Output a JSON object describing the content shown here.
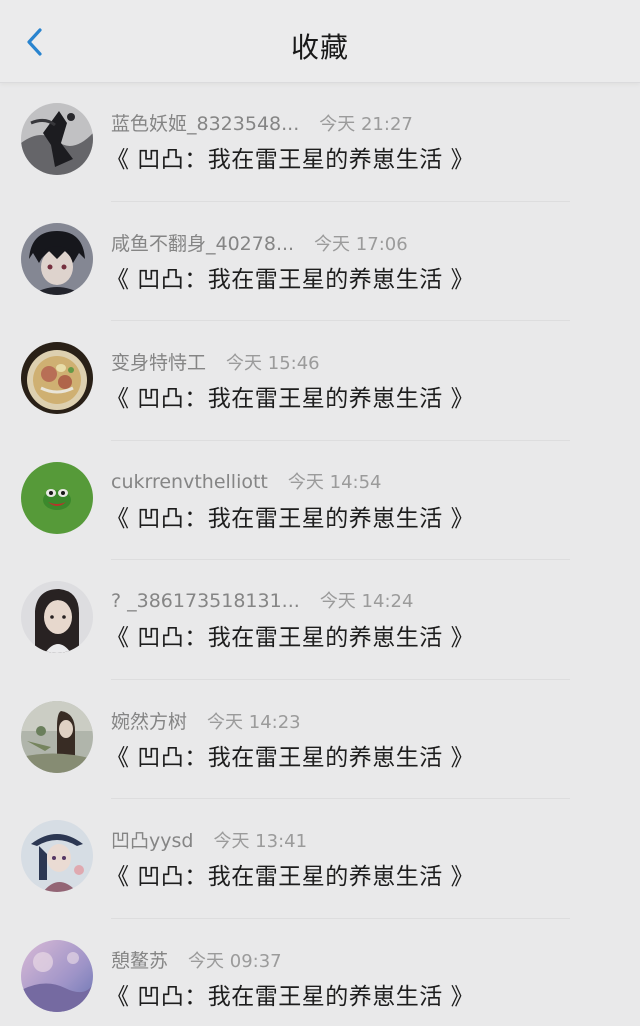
{
  "header": {
    "title": "收藏",
    "back_icon": "chevron-left-icon",
    "accent_color": "#2b8ad8"
  },
  "items": [
    {
      "name": "蓝色妖姬_8323548...",
      "time": "今天 21:27",
      "work": "《 凹凸：我在雷王星的养崽生活 》",
      "avatar": "dark-ink-art-avatar"
    },
    {
      "name": "咸鱼不翻身_40278...",
      "time": "今天 17:06",
      "work": "《 凹凸：我在雷王星的养崽生活 》",
      "avatar": "anime-boy-avatar"
    },
    {
      "name": "变身特恃工",
      "time": "今天 15:46",
      "work": "《 凹凸：我在雷王星的养崽生活 》",
      "avatar": "ramen-bowl-avatar"
    },
    {
      "name": "cukrrenvthelliott",
      "time": "今天 14:54",
      "work": "《 凹凸：我在雷王星的养崽生活 》",
      "avatar": "green-frog-avatar"
    },
    {
      "name": "? _386173518131...",
      "time": "今天 14:24",
      "work": "《 凹凸：我在雷王星的养崽生活 》",
      "avatar": "girl-photo-avatar"
    },
    {
      "name": "婉然方树",
      "time": "今天 14:23",
      "work": "《 凹凸：我在雷王星的养崽生活 》",
      "avatar": "illustration-avatar"
    },
    {
      "name": "凹凸yysd",
      "time": "今天 13:41",
      "work": "《 凹凸：我在雷王星的养崽生活 》",
      "avatar": "anime-character-avatar"
    },
    {
      "name": "憩鳌苏",
      "time": "今天 09:37",
      "work": "《 凹凸：我在雷王星的养崽生活 》",
      "avatar": "purple-sky-avatar"
    }
  ]
}
